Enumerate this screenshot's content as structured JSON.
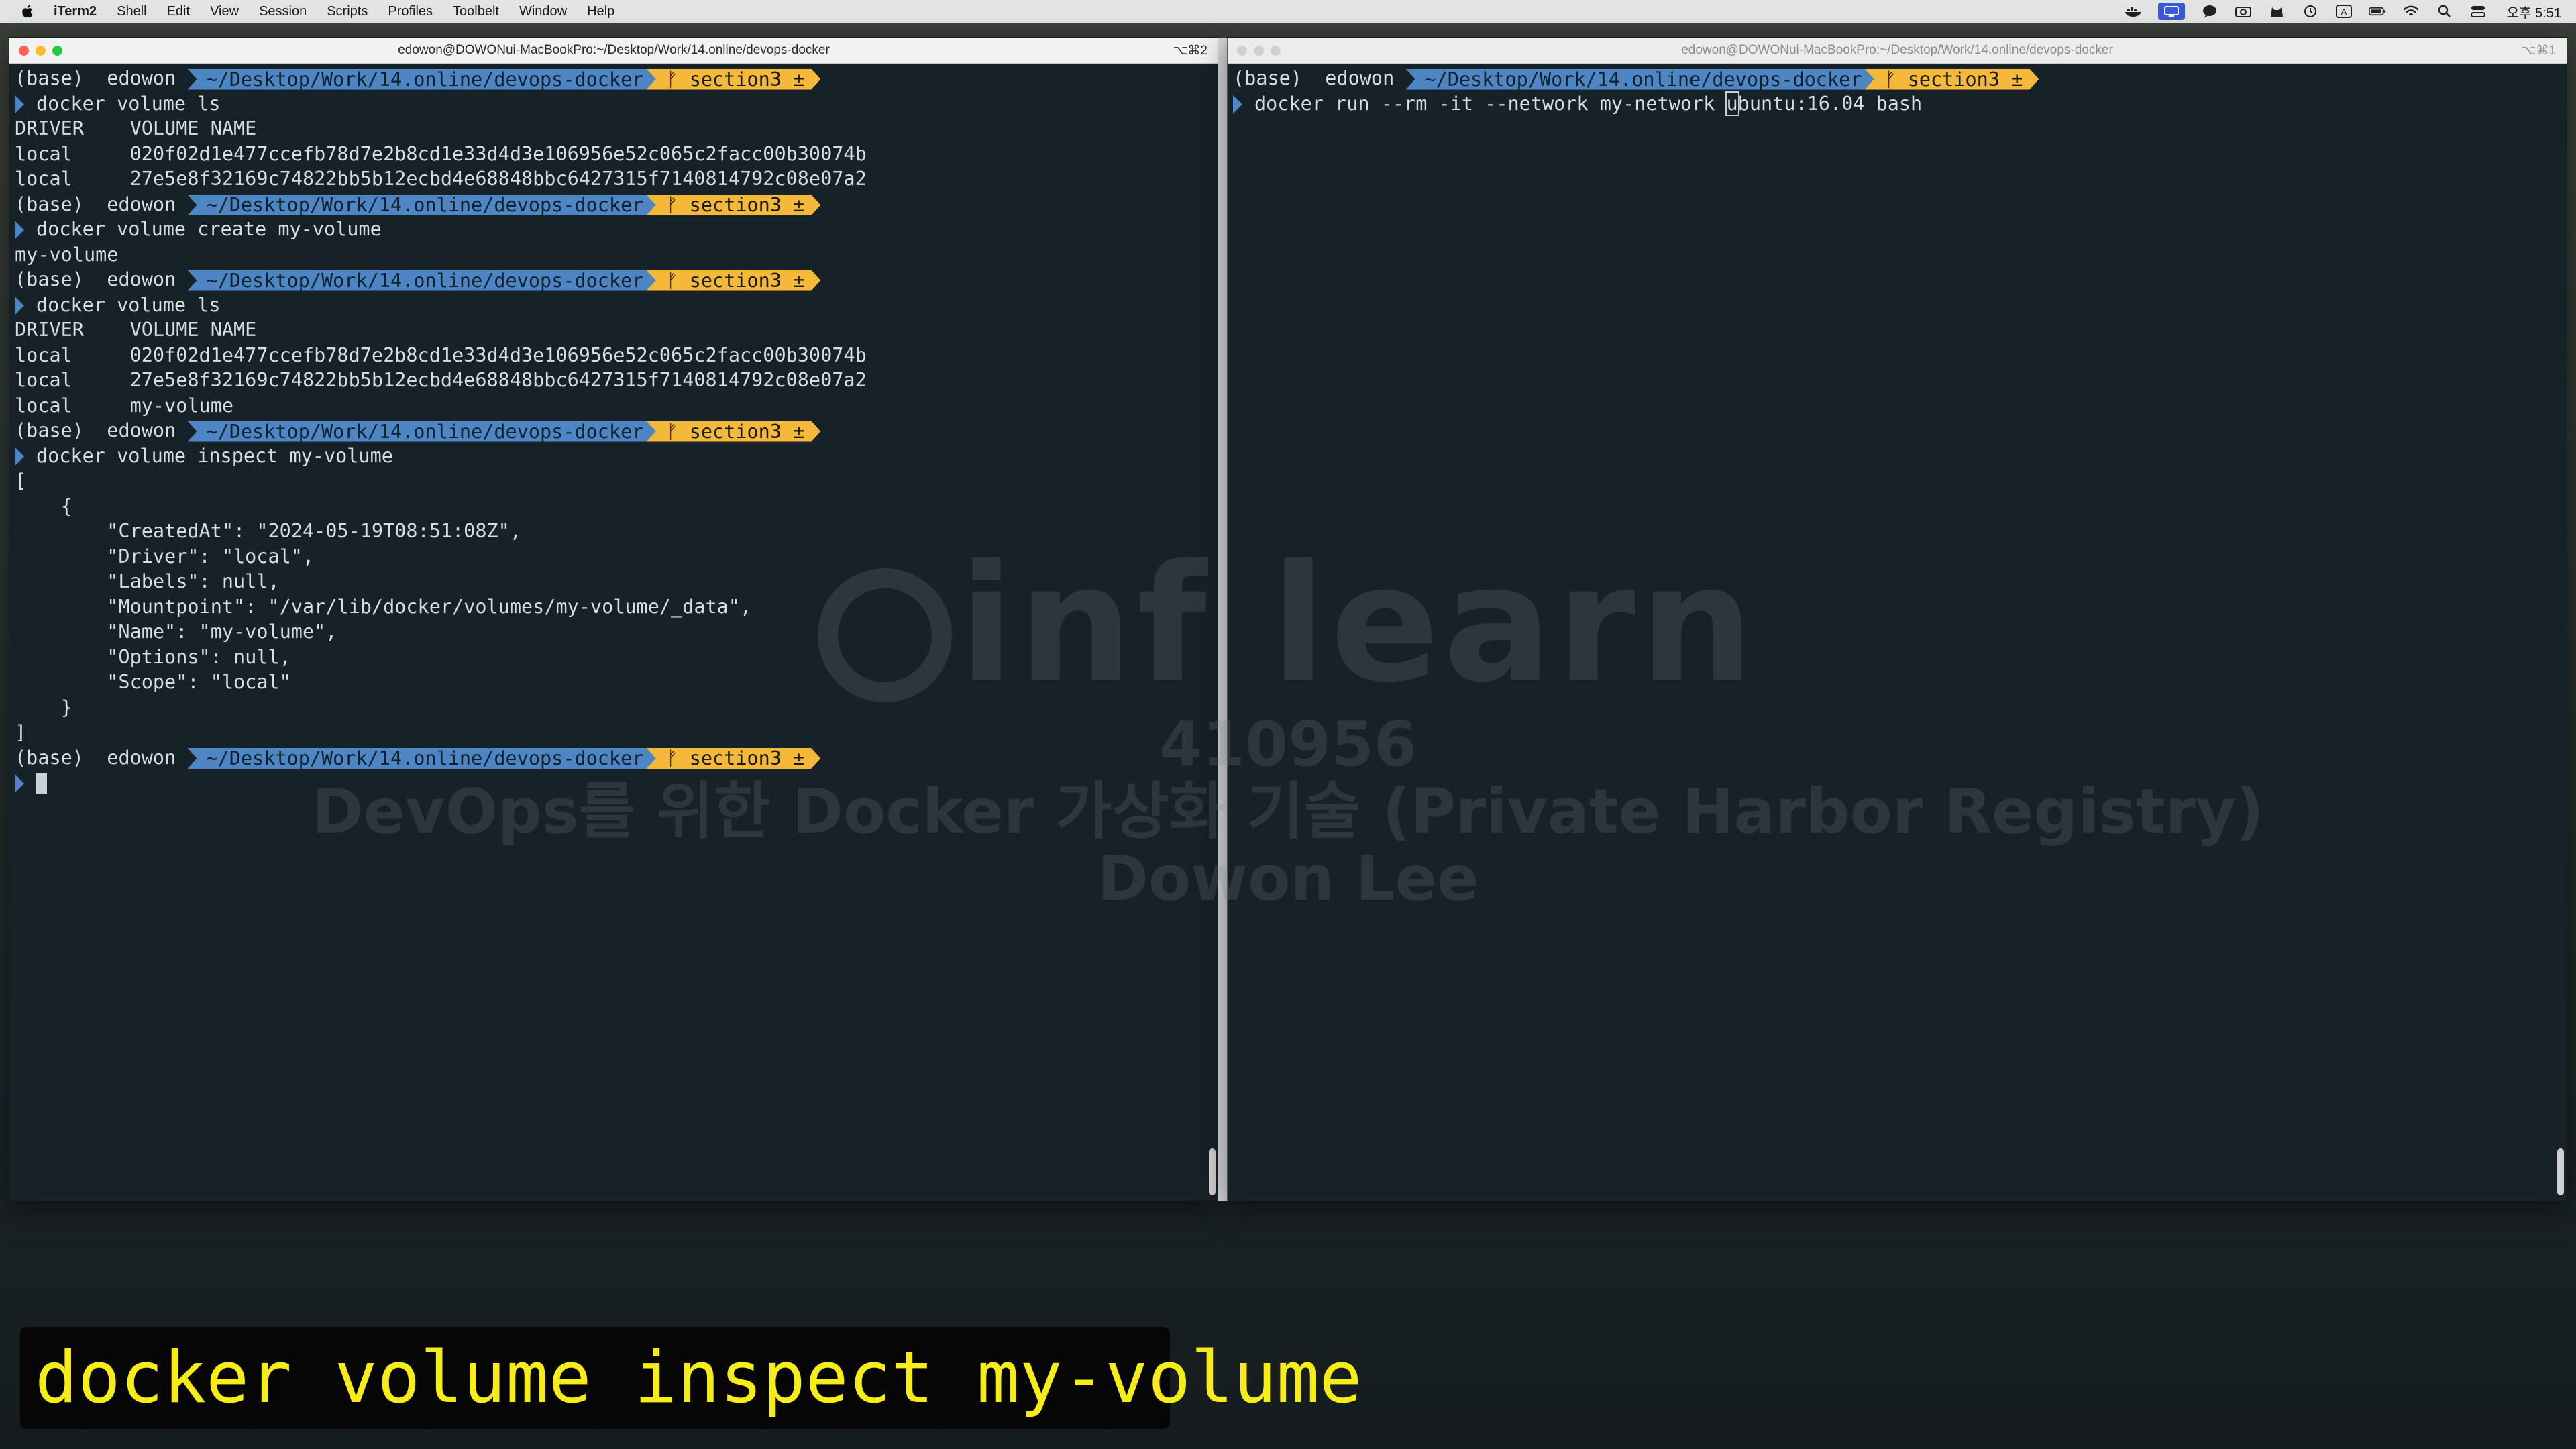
{
  "menubar": {
    "app_name": "iTerm2",
    "items": [
      "Shell",
      "Edit",
      "View",
      "Session",
      "Scripts",
      "Profiles",
      "Toolbelt",
      "Window",
      "Help"
    ],
    "clock": "오후 5:51"
  },
  "left_window": {
    "title": "edowon@DOWONui-MacBookPro:~/Desktop/Work/14.online/devops-docker",
    "shortcut": "⌥⌘2"
  },
  "right_window": {
    "title": "edowon@DOWONui-MacBookPro:~/Desktop/Work/14.online/devops-docker",
    "shortcut": "⌥⌘1"
  },
  "prompt": {
    "env": "(base)",
    "user": "edowon",
    "path": "~/Desktop/Work/14.online/devops-docker",
    "branch": "ᚠ section3 ±"
  },
  "left_terminal": {
    "cmd1": "docker volume ls",
    "header": "DRIVER    VOLUME NAME",
    "ls1_row1": "local     020f02d1e477ccefb78d7e2b8cd1e33d4d3e106956e52c065c2facc00b30074b",
    "ls1_row2": "local     27e5e8f32169c74822bb5b12ecbd4e68848bbc6427315f7140814792c08e07a2",
    "cmd2": "docker volume create my-volume",
    "create_out": "my-volume",
    "cmd3": "docker volume ls",
    "header2": "DRIVER    VOLUME NAME",
    "ls2_row1": "local     020f02d1e477ccefb78d7e2b8cd1e33d4d3e106956e52c065c2facc00b30074b",
    "ls2_row2": "local     27e5e8f32169c74822bb5b12ecbd4e68848bbc6427315f7140814792c08e07a2",
    "ls2_row3": "local     my-volume",
    "cmd4": "docker volume inspect my-volume",
    "json_lines": [
      "[",
      "    {",
      "        \"CreatedAt\": \"2024-05-19T08:51:08Z\",",
      "        \"Driver\": \"local\",",
      "        \"Labels\": null,",
      "        \"Mountpoint\": \"/var/lib/docker/volumes/my-volume/_data\",",
      "        \"Name\": \"my-volume\",",
      "        \"Options\": null,",
      "        \"Scope\": \"local\"",
      "    }",
      "]"
    ]
  },
  "right_terminal": {
    "cmd_before_cursor": "docker run --rm -it --network my-network ",
    "cmd_cursor_char": "u",
    "cmd_after_cursor": "buntu:16.04 bash"
  },
  "watermark": {
    "logo": "inf learn",
    "course_id": "410956",
    "course_title": "DevOps를 위한 Docker 가상화 기술 (Private Harbor Registry)",
    "author": "Dowon Lee"
  },
  "caption": "docker volume inspect my-volume"
}
